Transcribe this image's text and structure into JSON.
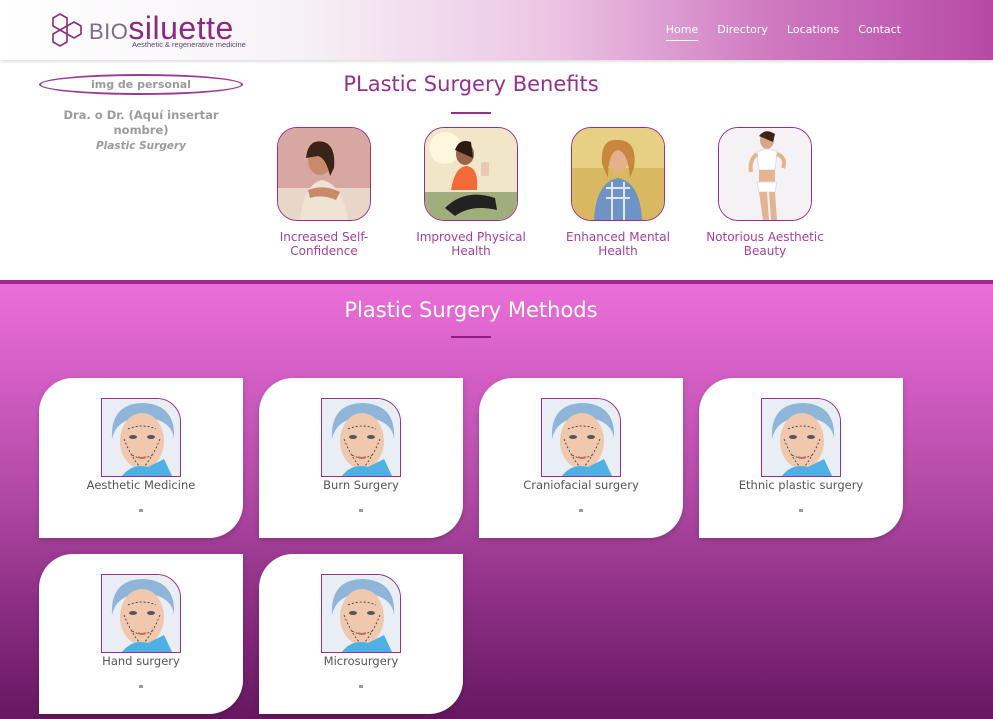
{
  "header": {
    "logo": {
      "prefix": "BIO",
      "name": "siluette",
      "tagline": "Aesthetic & regenerative medicine"
    },
    "nav": [
      {
        "label": "Home",
        "active": true
      },
      {
        "label": "Directory",
        "active": false
      },
      {
        "label": "Locations",
        "active": false
      },
      {
        "label": "Contact",
        "active": false
      }
    ]
  },
  "staff": {
    "image_alt": "img de personal",
    "name": "Dra. o Dr. (Aquí insertar nombre)",
    "role": "Plastic Surgery"
  },
  "benefits": {
    "title": "PLastic Surgery Benefits",
    "items": [
      {
        "label": "Increased Self-Confidence"
      },
      {
        "label": "Improved Physical Health"
      },
      {
        "label": "Enhanced Mental Health"
      },
      {
        "label": "Notorious Aesthetic Beauty"
      }
    ]
  },
  "methods": {
    "title": "Plastic Surgery Methods",
    "items": [
      {
        "label": "Aesthetic Medicine"
      },
      {
        "label": "Burn Surgery"
      },
      {
        "label": "Craniofacial surgery"
      },
      {
        "label": "Ethnic plastic surgery"
      },
      {
        "label": "Hand surgery"
      },
      {
        "label": "Microsurgery"
      }
    ]
  },
  "colors": {
    "brand_purple": "#94318f",
    "section_top": "#ea6fd9",
    "section_bottom": "#66175f"
  }
}
